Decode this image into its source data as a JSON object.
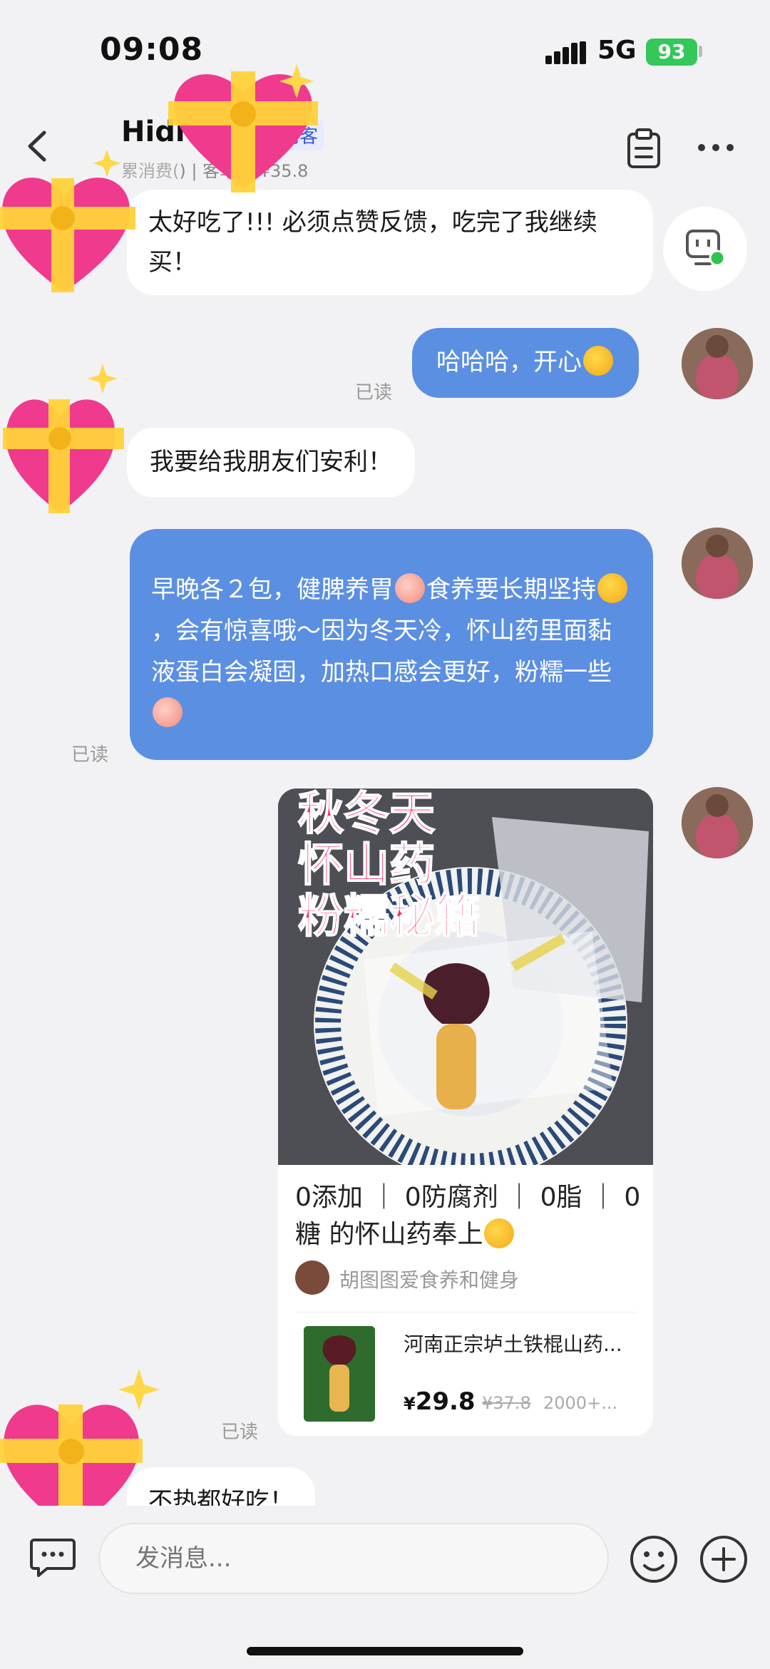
{
  "status": {
    "time": "09:08",
    "network": "5G",
    "battery": "93"
  },
  "header": {
    "name": "Hidi",
    "tag": "老客",
    "subinfo_prefix": "累消费",
    "subinfo_mid": "(",
    "subinfo_rest": ") | 客单价 ¥35.8"
  },
  "messages": {
    "m1": "太好吃了!!! 必须点赞反馈，吃完了我继续买！",
    "m2": "哈哈哈，开心",
    "m2_read": "已读",
    "m3": "我要给我朋友们安利！",
    "m4_a": "早晚各２包，健脾养胃",
    "m4_b": "食养要长期坚持",
    "m4_c": "，会有惊喜哦～因为冬天冷，怀山药里面黏液蛋白会凝固，加热口感会更好，粉糯一些",
    "m4_read": "已读",
    "m5_read": "已读",
    "m6": "不热都好吃！"
  },
  "card": {
    "photo_title_1": "秋冬天",
    "photo_title_2": "怀山药",
    "photo_title_3": "粉糯秘籍",
    "text": "0添加 ｜ 0防腐剂 ｜ 0脂 ｜ 0糖  的怀山药奉上",
    "author": "胡图图爱食养和健身",
    "product_title": "河南正宗垆土铁棍山药...",
    "price_symbol": "¥",
    "price": "29.8",
    "old_price": "¥37.8",
    "sales": "2000+..."
  },
  "input": {
    "placeholder": "发消息..."
  },
  "icons": {
    "back": "chevron-left-icon",
    "notes": "clipboard-icon",
    "more": "more-dots-icon",
    "robot": "robot-icon",
    "chat": "chat-bubble-icon",
    "emoji": "smile-icon",
    "plus": "plus-icon"
  },
  "colors": {
    "bubble_out": "#5b8fe2",
    "bubble_in": "#ffffff",
    "background": "#f2f2f4",
    "battery": "#34c759"
  }
}
